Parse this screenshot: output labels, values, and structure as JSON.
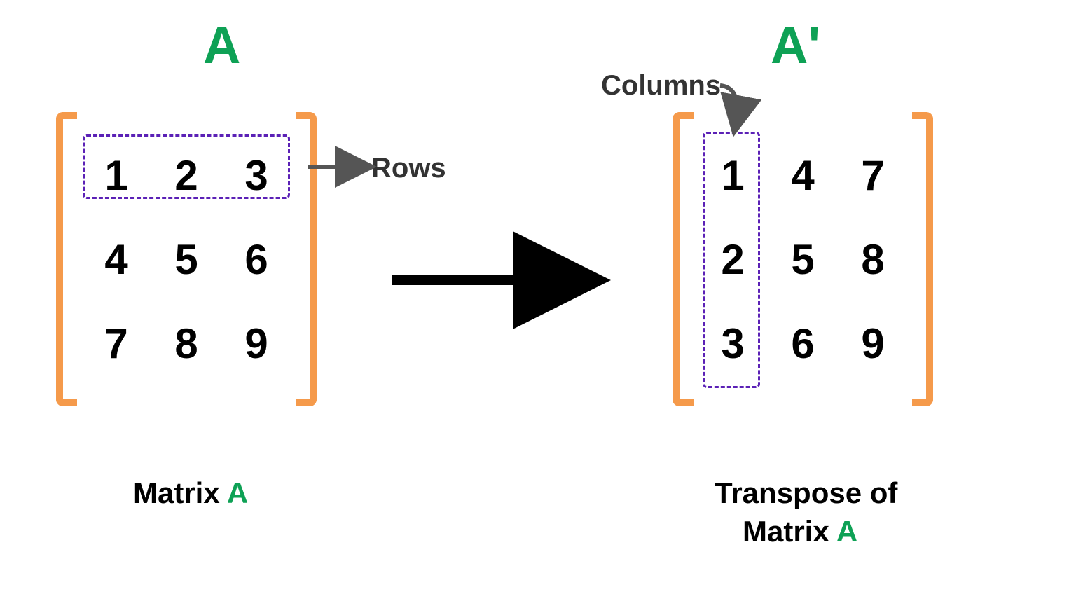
{
  "left": {
    "title": "A",
    "cells": [
      "1",
      "2",
      "3",
      "4",
      "5",
      "6",
      "7",
      "8",
      "9"
    ],
    "captionPrefix": "Matrix ",
    "captionA": "A",
    "rowsLabel": "Rows"
  },
  "right": {
    "title": "A'",
    "cells": [
      "1",
      "4",
      "7",
      "2",
      "5",
      "8",
      "3",
      "6",
      "9"
    ],
    "captionLine1Prefix": "Transpose of",
    "captionLine2Prefix": "Matrix ",
    "captionA": "A",
    "columnsLabel": "Columns"
  },
  "chart_data": {
    "type": "table",
    "matrix_A": [
      [
        1,
        2,
        3
      ],
      [
        4,
        5,
        6
      ],
      [
        7,
        8,
        9
      ]
    ],
    "matrix_A_transpose": [
      [
        1,
        4,
        7
      ],
      [
        2,
        5,
        8
      ],
      [
        3,
        6,
        9
      ]
    ],
    "highlighted_row_in_A": [
      1,
      2,
      3
    ],
    "highlighted_column_in_A_transpose": [
      1,
      2,
      3
    ],
    "operation": "transpose"
  }
}
